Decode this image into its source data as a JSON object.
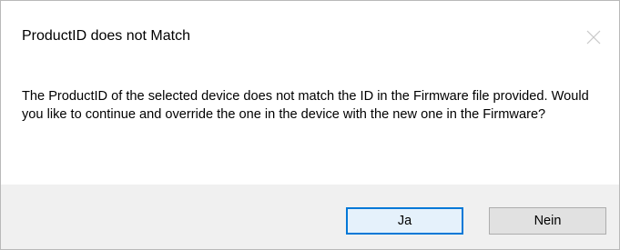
{
  "dialog": {
    "title": "ProductID does not Match",
    "message": "The ProductID of the selected device does not match the ID in the Firmware file provided. Would you like to continue and override the one in the device with the new one in the Firmware?",
    "buttons": {
      "yes_label": "Ja",
      "no_label": "Nein"
    }
  },
  "colors": {
    "accent": "#0078d7",
    "footer_background": "#f0f0f0",
    "button_background": "#e1e1e1"
  },
  "icons": {
    "close": "close-icon"
  }
}
